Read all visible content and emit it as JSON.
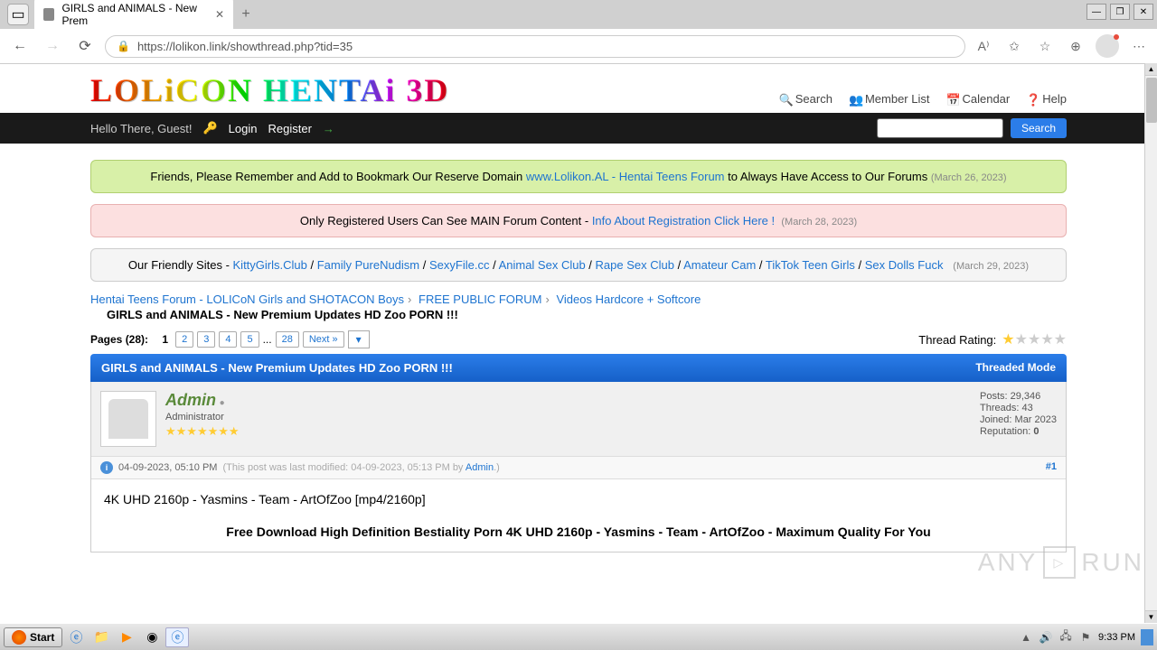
{
  "browser": {
    "tab_title": "GIRLS and ANIMALS - New Prem",
    "url": "https://lolikon.link/showthread.php?tid=35"
  },
  "header": {
    "logo_text": "LOLiCON HENTAi 3D",
    "links": {
      "search": "Search",
      "members": "Member List",
      "calendar": "Calendar",
      "help": "Help"
    }
  },
  "blackbar": {
    "greeting": "Hello There, Guest!",
    "login": "Login",
    "register": "Register",
    "search_btn": "Search"
  },
  "notices": {
    "n1_pre": "Friends, Please Remember and Add to Bookmark Our Reserve Domain ",
    "n1_link": "www.Lolikon.AL - Hentai Teens Forum",
    "n1_post": " to Always Have Access to Our Forums  ",
    "n1_date": "(March 26, 2023)",
    "n2_pre": "Only Registered Users Can See MAIN Forum Content - ",
    "n2_link": "Info About Registration Click Here !",
    "n2_date": "(March 28, 2023)",
    "n3_pre": "Our Friendly Sites - ",
    "n3_links": [
      "KittyGirls.Club",
      "Family PureNudism",
      "SexyFile.cc",
      "Animal Sex Club",
      "Rape Sex Club",
      "Amateur Cam",
      "TikTok Teen Girls",
      "Sex Dolls Fuck"
    ],
    "n3_date": "(March 29, 2023)"
  },
  "breadcrumb": {
    "l1": "Hentai Teens Forum - LOLICoN Girls and SHOTACON Boys",
    "l2": "FREE PUBLIC FORUM",
    "l3": "Videos Hardcore + Softcore",
    "current": "GIRLS and ANIMALS - New Premium Updates HD Zoo PORN !!!"
  },
  "pager": {
    "label": "Pages (28):",
    "current": "1",
    "pages": [
      "2",
      "3",
      "4",
      "5"
    ],
    "dots": "...",
    "last": "28",
    "next": "Next »"
  },
  "rating_label": "Thread Rating:",
  "thread": {
    "title": "GIRLS and ANIMALS - New Premium Updates HD Zoo PORN !!!",
    "mode": "Threaded Mode"
  },
  "post": {
    "username": "Admin",
    "role": "Administrator",
    "stats": {
      "posts": "Posts: 29,346",
      "threads": "Threads: 43",
      "joined": "Joined: Mar 2023",
      "rep_label": "Reputation: ",
      "rep_val": "0"
    },
    "timestamp": "04-09-2023, 05:10 PM",
    "modified": "(This post was last modified: 04-09-2023, 05:13 PM by ",
    "mod_user": "Admin",
    "mod_suffix": ".)",
    "num": "#1",
    "body_title": "4K UHD 2160p - Yasmins - Team - ArtOfZoo [mp4/2160p]",
    "body_dl": "Free Download High Definition Bestiality Porn  4K UHD 2160p - Yasmins - Team - ArtOfZoo - Maximum Quality For You"
  },
  "watermark": {
    "text_a": "ANY",
    "text_b": "RUN"
  },
  "taskbar": {
    "start": "Start",
    "clock": "9:33 PM"
  }
}
